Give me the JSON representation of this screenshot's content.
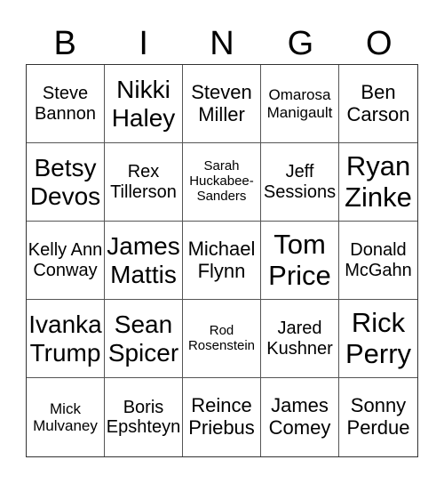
{
  "header": {
    "letters": [
      "B",
      "I",
      "N",
      "G",
      "O"
    ]
  },
  "cells": [
    {
      "text": "Steve Bannon",
      "size": "s3"
    },
    {
      "text": "Nikki Haley",
      "size": "s5"
    },
    {
      "text": "Steven Miller",
      "size": "s4"
    },
    {
      "text": "Omarosa Manigault",
      "size": "s2"
    },
    {
      "text": "Ben Carson",
      "size": "s4"
    },
    {
      "text": "Betsy Devos",
      "size": "s5"
    },
    {
      "text": "Rex Tillerson",
      "size": "s3"
    },
    {
      "text": "Sarah Huckabee-Sanders",
      "size": "s1"
    },
    {
      "text": "Jeff Sessions",
      "size": "s3"
    },
    {
      "text": "Ryan Zinke",
      "size": "s6"
    },
    {
      "text": "Kelly Ann Conway",
      "size": "s3"
    },
    {
      "text": "James Mattis",
      "size": "s5"
    },
    {
      "text": "Michael Flynn",
      "size": "s4"
    },
    {
      "text": "Tom Price",
      "size": "s6"
    },
    {
      "text": "Donald McGahn",
      "size": "s3"
    },
    {
      "text": "Ivanka Trump",
      "size": "s5"
    },
    {
      "text": "Sean Spicer",
      "size": "s5"
    },
    {
      "text": "Rod Rosenstein",
      "size": "s1"
    },
    {
      "text": "Jared Kushner",
      "size": "s3"
    },
    {
      "text": "Rick Perry",
      "size": "s6"
    },
    {
      "text": "Mick Mulvaney",
      "size": "s2"
    },
    {
      "text": "Boris Epshteyn",
      "size": "s3"
    },
    {
      "text": "Reince Priebus",
      "size": "s4"
    },
    {
      "text": "James Comey",
      "size": "s4"
    },
    {
      "text": "Sonny Perdue",
      "size": "s4"
    }
  ]
}
